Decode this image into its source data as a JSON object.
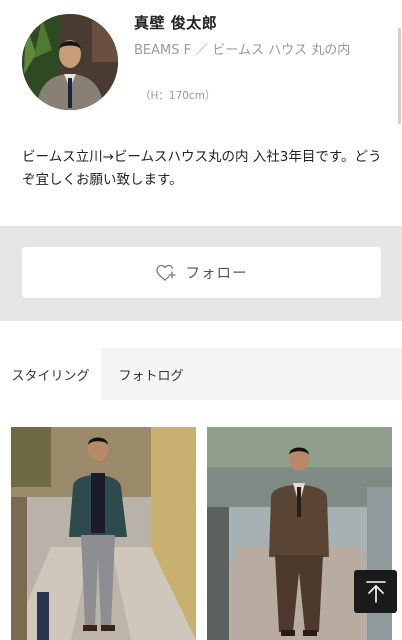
{
  "profile": {
    "name": "真壁 俊太郎",
    "shop": "BEAMS F ／ ビームス ハウス 丸の内",
    "height": "（H：170cm）",
    "bio": "ビームス立川→ビームスハウス丸の内 入社3年目です。どうぞ宜しくお願い致します。"
  },
  "follow": {
    "label": "フォロー",
    "icon": "heart-plus-icon"
  },
  "tabs": [
    {
      "label": "スタイリング",
      "active": true
    },
    {
      "label": "フォトログ",
      "active": false
    }
  ],
  "photos": [
    {
      "description_icon": "styling-photo"
    },
    {
      "description_icon": "styling-photo"
    }
  ],
  "scroll_top": {
    "icon": "arrow-up-icon"
  },
  "colors": {
    "accent": "#1b1b1b",
    "band": "#e6e6e6",
    "muted": "#9a9a9a"
  }
}
